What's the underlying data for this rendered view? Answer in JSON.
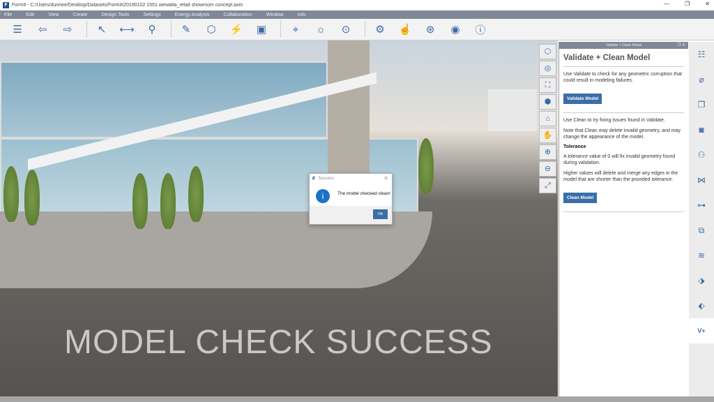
{
  "window": {
    "title": "FormIt - C:/Users/dunnee/Desktop/Datasets/FormIt/20190102 1551 wewatta_retail showroom concept.axm",
    "logo": "F",
    "controls": [
      "—",
      "❐",
      "✕"
    ]
  },
  "menu": [
    "File",
    "Edit",
    "View",
    "Create",
    "Design Tools",
    "Settings",
    "Energy Analysis",
    "Collaboration",
    "Window",
    "Info"
  ],
  "toolbar": [
    {
      "name": "layers-icon",
      "g": "☰"
    },
    {
      "name": "undo-icon",
      "g": "⇦"
    },
    {
      "name": "redo-icon",
      "g": "⇨"
    },
    {
      "sep": true
    },
    {
      "name": "select-icon",
      "g": "↖"
    },
    {
      "name": "measure-icon",
      "g": "⟷"
    },
    {
      "name": "pin-icon",
      "g": "⚲"
    },
    {
      "sep": true
    },
    {
      "name": "draw-icon",
      "g": "✎"
    },
    {
      "name": "cube-add-icon",
      "g": "⬡"
    },
    {
      "name": "generate-icon",
      "g": "⚡"
    },
    {
      "name": "group-icon",
      "g": "▣"
    },
    {
      "sep": true
    },
    {
      "name": "location-icon",
      "g": "⌖"
    },
    {
      "name": "sun-icon",
      "g": "☼"
    },
    {
      "name": "scale-icon",
      "g": "⊙"
    },
    {
      "sep": true
    },
    {
      "name": "settings-icon",
      "g": "⚙"
    },
    {
      "name": "touch-icon",
      "g": "☝"
    },
    {
      "name": "share-icon",
      "g": "⊛"
    },
    {
      "name": "user-icon",
      "g": "◉"
    },
    {
      "name": "info-icon",
      "g": "ⓘ"
    }
  ],
  "viewtools": [
    "⬡",
    "◎",
    "⛶",
    "⬢",
    "⌂",
    "✋",
    "⊕",
    "⊖",
    "⤢"
  ],
  "watermark": "MODEL CHECK SUCCESS",
  "dialog": {
    "title": "Success",
    "logo": "F",
    "message": "The model checked clean!",
    "ok": "OK",
    "icon": "i",
    "close": "✕"
  },
  "panel": {
    "header": "Validate + Clean Model",
    "controls": "❐ ✕",
    "title": "Validate + Clean Model",
    "validate_text": "Use Validate to check for any geometric corruption that could result in modeling failures.",
    "validate_button": "Validate Model",
    "clean_text": "Use Clean to try fixing issues found in Validate.",
    "note_text": "Note that Clean may delete invalid geometry, and may change the appearance of the model.",
    "tolerance_heading": "Tolerance",
    "tolerance_text1": "A tolerance value of 0 will fix invalid geometry found during validation.",
    "tolerance_text2": "Higher values will delete and merge any edges in the model that are shorter than the provided tolerance.",
    "clean_button": "Clean Model"
  },
  "rightstrip": [
    "☷",
    "⌀",
    "❐",
    "◙",
    "⚇",
    "⋈",
    "⊶",
    "⧉",
    "≋",
    "⬗",
    "⬖",
    "V+"
  ]
}
